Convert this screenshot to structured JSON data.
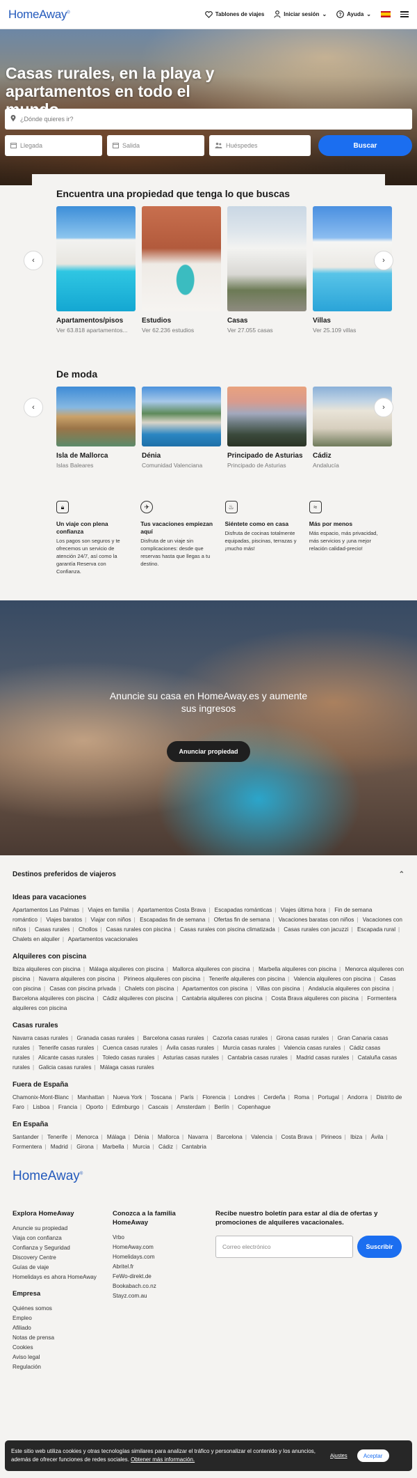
{
  "header": {
    "logo": "HomeAway",
    "boards": "Tablones de viajes",
    "login": "Iniciar sesión",
    "help": "Ayuda"
  },
  "hero": {
    "title": "Casas rurales, en la playa y apartamentos en todo el mundo",
    "search_placeholder": "¿Dónde quieres ir?",
    "arrival": "Llegada",
    "departure": "Salida",
    "guests": "Huéspedes",
    "search_button": "Buscar"
  },
  "property_types": {
    "title": "Encuentra una propiedad que tenga lo que buscas",
    "items": [
      {
        "name": "Apartamentos/pisos",
        "sub": "Ver 63.818 apartamentos..."
      },
      {
        "name": "Estudios",
        "sub": "Ver 62.236 estudios"
      },
      {
        "name": "Casas",
        "sub": "Ver 27.055 casas"
      },
      {
        "name": "Villas",
        "sub": "Ver 25.109 villas"
      }
    ]
  },
  "trending": {
    "title": "De moda",
    "items": [
      {
        "name": "Isla de Mallorca",
        "sub": "Islas Baleares"
      },
      {
        "name": "Dénia",
        "sub": "Comunidad Valenciana"
      },
      {
        "name": "Principado de Asturias",
        "sub": "Principado de Asturias"
      },
      {
        "name": "Cádiz",
        "sub": "Andalucía"
      }
    ]
  },
  "features": [
    {
      "title": "Un viaje con plena confianza",
      "desc": "Los pagos son seguros y te ofrecemos un servicio de atención 24/7, así como la garantía Reserva con Confianza."
    },
    {
      "title": "Tus vacaciones empiezan aquí",
      "desc": "Disfruta de un viaje sin complicaciones: desde que reservas hasta que llegas a tu destino."
    },
    {
      "title": "Siéntete como en casa",
      "desc": "Disfruta de cocinas totalmente equipadas, piscinas, terrazas y ¡mucho más!"
    },
    {
      "title": "Más por menos",
      "desc": "Más espacio, más privacidad, más servicios y ¡una mejor relación calidad-precio!"
    }
  ],
  "owner": {
    "title": "Anuncie su casa en HomeAway.es y aumente sus ingresos",
    "button": "Anunciar propiedad"
  },
  "destinations": {
    "title": "Destinos preferidos de viajeros",
    "groups": [
      {
        "title": "Ideas para vacaciones",
        "links": [
          "Apartamentos Las Palmas",
          "Viajes en familia",
          "Apartamentos Costa Brava",
          "Escapadas románticas",
          "Viajes última hora",
          "Fin de semana romántico",
          "Viajes baratos",
          "Viajar con niños",
          "Escapadas fin de semana",
          "Ofertas fin de semana",
          "Vacaciones baratas con niños",
          "Vacaciones con niños",
          "Casas rurales",
          "Chollos",
          "Casas rurales con piscina",
          "Casas rurales con piscina climatizada",
          "Casas rurales con jacuzzi",
          "Escapada rural",
          "Chalets en alquiler",
          "Apartamentos vacacionales"
        ]
      },
      {
        "title": "Alquileres con piscina",
        "links": [
          "Ibiza alquileres con piscina",
          "Málaga alquileres con piscina",
          "Mallorca alquileres con piscina",
          "Marbella alquileres con piscina",
          "Menorca alquileres con piscina",
          "Navarra alquileres con piscina",
          "Pirineos alquileres con piscina",
          "Tenerife alquileres con piscina",
          "Valencia alquileres con piscina",
          "Casas con piscina",
          "Casas con piscina privada",
          "Chalets con piscina",
          "Apartamentos con piscina",
          "Villas con piscina",
          "Andalucía alquileres con piscina",
          "Barcelona alquileres con piscina",
          "Cádiz alquileres con piscina",
          "Cantabria alquileres con piscina",
          "Costa Brava alquileres con piscina",
          "Formentera alquileres con piscina"
        ]
      },
      {
        "title": "Casas rurales",
        "links": [
          "Navarra casas rurales",
          "Granada casas rurales",
          "Barcelona casas rurales",
          "Cazorla casas rurales",
          "Girona casas rurales",
          "Gran Canaria casas rurales",
          "Tenerife casas rurales",
          "Cuenca casas rurales",
          "Ávila casas rurales",
          "Murcia casas rurales",
          "Valencia casas rurales",
          "Cádiz casas rurales",
          "Alicante casas rurales",
          "Toledo casas rurales",
          "Asturias casas rurales",
          "Cantabria casas rurales",
          "Madrid casas rurales",
          "Cataluña casas rurales",
          "Galicia casas rurales",
          "Málaga casas rurales"
        ]
      },
      {
        "title": "Fuera de España",
        "links": [
          "Chamonix-Mont-Blanc",
          "Manhattan",
          "Nueva York",
          "Toscana",
          "París",
          "Florencia",
          "Londres",
          "Cerdeña",
          "Roma",
          "Portugal",
          "Andorra",
          "Distrito de Faro",
          "Lisboa",
          "Francia",
          "Oporto",
          "Edimburgo",
          "Cascais",
          "Amsterdam",
          "Berlín",
          "Copenhague"
        ]
      },
      {
        "title": "En España",
        "links": [
          "Santander",
          "Tenerife",
          "Menorca",
          "Málaga",
          "Dénia",
          "Mallorca",
          "Navarra",
          "Barcelona",
          "Valencia",
          "Costa Brava",
          "Pirineos",
          "Ibiza",
          "Ávila",
          "Formentera",
          "Madrid",
          "Girona",
          "Marbella",
          "Murcia",
          "Cádiz",
          "Cantabria"
        ]
      }
    ]
  },
  "footer": {
    "logo": "HomeAway",
    "explore_title": "Explora HomeAway",
    "explore_links": [
      "Anuncie su propiedad",
      "Viaja con confianza",
      "Confianza y Seguridad",
      "Discovery Centre",
      "Guías de viaje",
      "Homelidays es ahora HomeAway"
    ],
    "company_title": "Empresa",
    "company_links": [
      "Quiénes somos",
      "Empleo",
      "Afiliado",
      "Notas de prensa",
      "Cookies",
      "Aviso legal",
      "Regulación"
    ],
    "family_title": "Conozca a la familia HomeAway",
    "family_links": [
      "Vrbo",
      "HomeAway.com",
      "Homelidays.com",
      "Abritel.fr",
      "FeWo-direkt.de",
      "Bookabach.co.nz",
      "Stayz.com.au"
    ],
    "newsletter_title": "Recibe nuestro boletín para estar al día de ofertas y promociones de alquileres vacacionales.",
    "email_placeholder": "Correo electrónico",
    "subscribe": "Suscribir"
  },
  "cookie": {
    "text": "Este sitio web utiliza cookies y otras tecnologías similares para analizar el tráfico y personalizar el contenido y los anuncios, además de ofrecer funciones de redes sociales.",
    "link": "Obtener más información.",
    "adjust": "Ajustes",
    "accept": "Aceptar"
  }
}
